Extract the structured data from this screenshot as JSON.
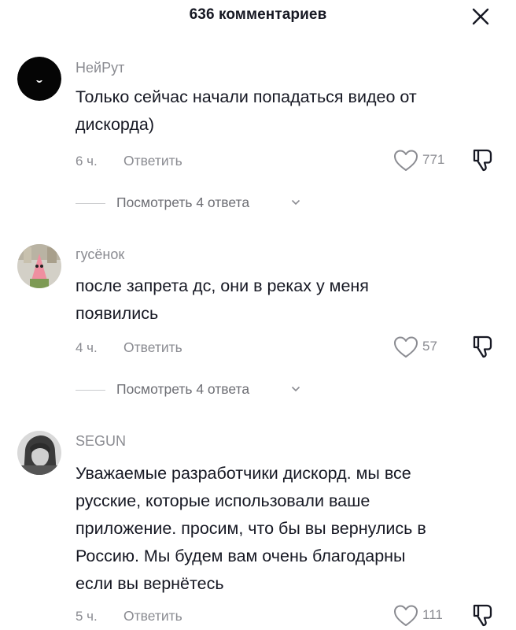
{
  "header": {
    "title": "636 комментариев",
    "close_icon": "close-icon"
  },
  "colors": {
    "text": "#161823",
    "secondary": "#8a8b91",
    "divider": "#c9cacd"
  },
  "comments": [
    {
      "username": "НейРут",
      "text_lines": [
        "Только сейчас начали попадаться видео от",
        "дискорда)"
      ],
      "time": "6 ч.",
      "reply_label": "Ответить",
      "likes": "771",
      "replies_label": "Посмотреть 4 ответа"
    },
    {
      "username": "гусёнок",
      "text_lines": [
        "после запрета дс, они в реках у меня",
        "появились"
      ],
      "time": "4 ч.",
      "reply_label": "Ответить",
      "likes": "57",
      "replies_label": "Посмотреть 4 ответа"
    },
    {
      "username": "SEGUN",
      "text_lines": [
        "Уважаемые разработчики дискорд. мы все",
        "русские, которые использовали ваше",
        "приложение. просим, что бы вы вернулись в",
        "Россию. Мы будем вам очень благодарны",
        "если вы вернётесь"
      ],
      "time": "5 ч.",
      "reply_label": "Ответить",
      "likes": "111"
    }
  ]
}
